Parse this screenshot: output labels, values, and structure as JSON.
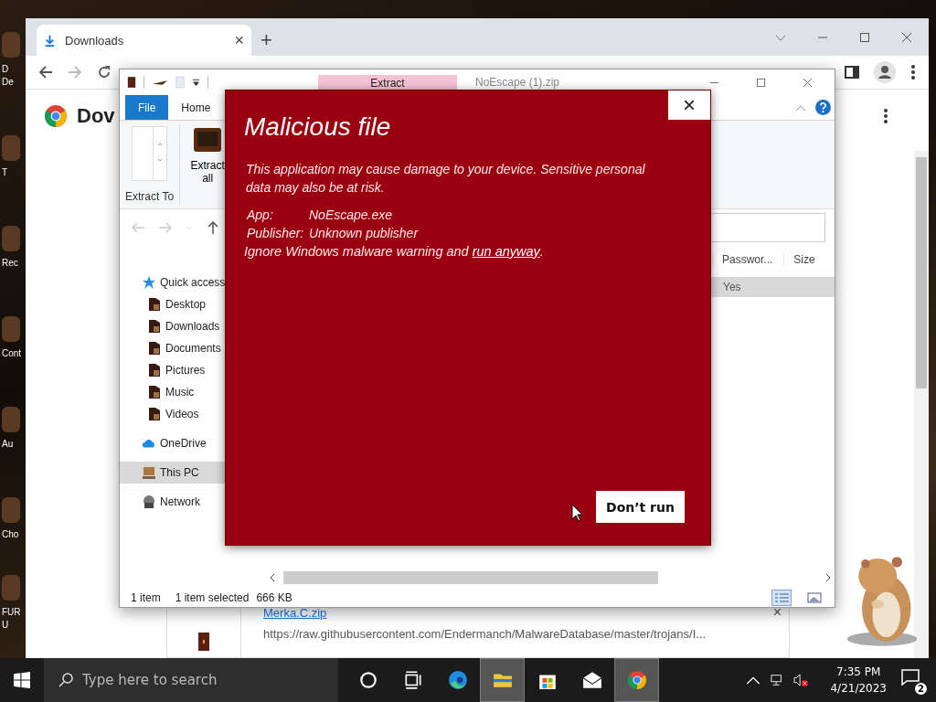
{
  "desktop": {
    "icons": [
      {
        "lines": [
          "D",
          "De"
        ]
      },
      {
        "lines": [
          "T"
        ]
      },
      {
        "lines": [
          "Rec"
        ]
      },
      {
        "lines": [
          "Cont"
        ]
      },
      {
        "lines": [
          "Au"
        ]
      },
      {
        "lines": [
          "Cho"
        ]
      },
      {
        "lines": [
          "FUR",
          "U"
        ]
      }
    ]
  },
  "browser": {
    "tab": {
      "title": "Downloads",
      "close": "×"
    },
    "new_tab": "+",
    "page_title": "Dov",
    "download": {
      "file_name": "Merka.C.zip",
      "url": "https://raw.githubusercontent.com/Endermanch/MalwareDatabase/master/trojans/I...",
      "close": "×"
    }
  },
  "explorer": {
    "title": "NoEscape (1).zip",
    "contextual_tab": "Extract",
    "ribbon_tabs": [
      "File",
      "Home"
    ],
    "ribbon": {
      "extract_to": "Extract To",
      "extract_all": "Extract all"
    },
    "nav": [
      {
        "label": "Quick access",
        "kind": "star",
        "selected": false,
        "children": [
          {
            "label": "Desktop",
            "kind": "folder",
            "selected": false
          },
          {
            "label": "Downloads",
            "kind": "folder",
            "selected": false
          },
          {
            "label": "Documents",
            "kind": "folder",
            "selected": false
          },
          {
            "label": "Pictures",
            "kind": "folder",
            "selected": false
          },
          {
            "label": "Music",
            "kind": "folder",
            "selected": false
          },
          {
            "label": "Videos",
            "kind": "folder",
            "selected": false
          }
        ]
      },
      {
        "label": "OneDrive",
        "kind": "cloud",
        "selected": false
      },
      {
        "label": "This PC",
        "kind": "pc",
        "selected": true
      },
      {
        "label": "Network",
        "kind": "network",
        "selected": false
      }
    ],
    "columns": [
      "Passwor...",
      "Size"
    ],
    "rows": [
      {
        "cells": [
          "Yes"
        ],
        "selected": true
      }
    ],
    "status": [
      "1 item",
      "1 item selected",
      "666 KB"
    ]
  },
  "dialog": {
    "title": "Malicious file",
    "message": "This application may cause damage to your device. Sensitive personal data may also be at risk.",
    "fields": [
      {
        "label": "App:",
        "value": "NoEscape.exe"
      },
      {
        "label": "Publisher:",
        "value": "Unknown publisher"
      }
    ],
    "override": {
      "text": "Ignore Windows malware warning and",
      "link": "run anyway",
      "suffix": "."
    },
    "button": "Don’t run",
    "close": "×"
  },
  "taskbar": {
    "search_placeholder": "Type here to search",
    "apps": [
      {
        "kind": "cortana",
        "active": false
      },
      {
        "kind": "taskview",
        "active": false
      },
      {
        "kind": "edge",
        "active": false
      },
      {
        "kind": "explorer",
        "active": true
      },
      {
        "kind": "store",
        "active": false
      },
      {
        "kind": "mail",
        "active": false
      },
      {
        "kind": "chrome",
        "active": true
      }
    ],
    "time": "7:35 PM",
    "date": "4/21/2023",
    "notifications": "2"
  }
}
